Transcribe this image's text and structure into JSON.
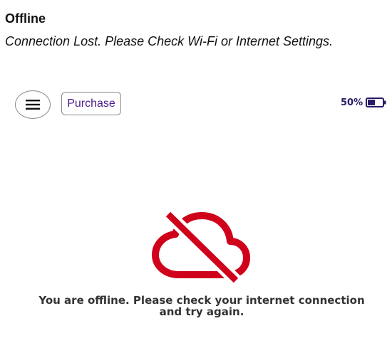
{
  "header": {
    "title": "Offline",
    "subtitle": "Connection Lost. Please Check Wi-Fi or Internet Settings."
  },
  "toolbar": {
    "menu_icon": "hamburger-menu-icon",
    "purchase_label": "Purchase"
  },
  "battery": {
    "label": "50%",
    "level": 0.5,
    "color": "#2a1a66"
  },
  "main": {
    "status_icon": "cloud-offline-icon",
    "status_icon_color": "#d0021b",
    "message": "You are offline. Please check your internet connection and try again."
  },
  "colors": {
    "accent": "#4a1c8c",
    "error": "#d0021b"
  }
}
